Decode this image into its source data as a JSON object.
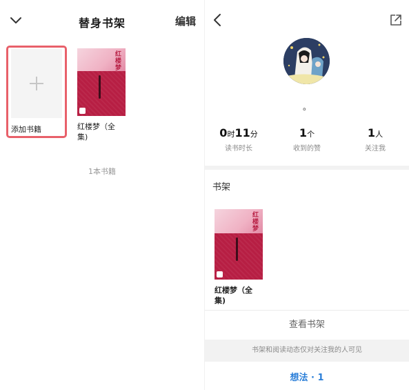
{
  "left": {
    "title": "替身书架",
    "edit_label": "编辑",
    "add_book_label": "添加书籍",
    "books": [
      {
        "title": "红楼梦（全集)",
        "cover_text": "红楼梦"
      }
    ],
    "book_count": "1本书籍"
  },
  "right": {
    "nickname": "。",
    "stats": {
      "reading_time": {
        "hours": "0",
        "hours_unit": "时",
        "minutes": "11",
        "minutes_unit": "分",
        "label": "读书时长"
      },
      "likes": {
        "value": "1",
        "unit": "个",
        "label": "收到的赞"
      },
      "followers": {
        "value": "1",
        "unit": "人",
        "label": "关注我"
      }
    },
    "shelf_heading": "书架",
    "book": {
      "title": "红楼梦（全集)",
      "cover_text": "红楼梦"
    },
    "view_shelf_label": "查看书架",
    "privacy_note": "书架和阅读动态仅对关注我的人可见",
    "thoughts_label": "想法",
    "thoughts_count": "1"
  },
  "icons": {
    "collapse": "chevron-down-icon",
    "back": "chevron-left-icon",
    "share": "share-external-icon",
    "add": "plus-icon"
  },
  "colors": {
    "highlight_border": "#e8606a",
    "cover_red": "#b71e43",
    "link_blue": "#2a7ed8"
  }
}
